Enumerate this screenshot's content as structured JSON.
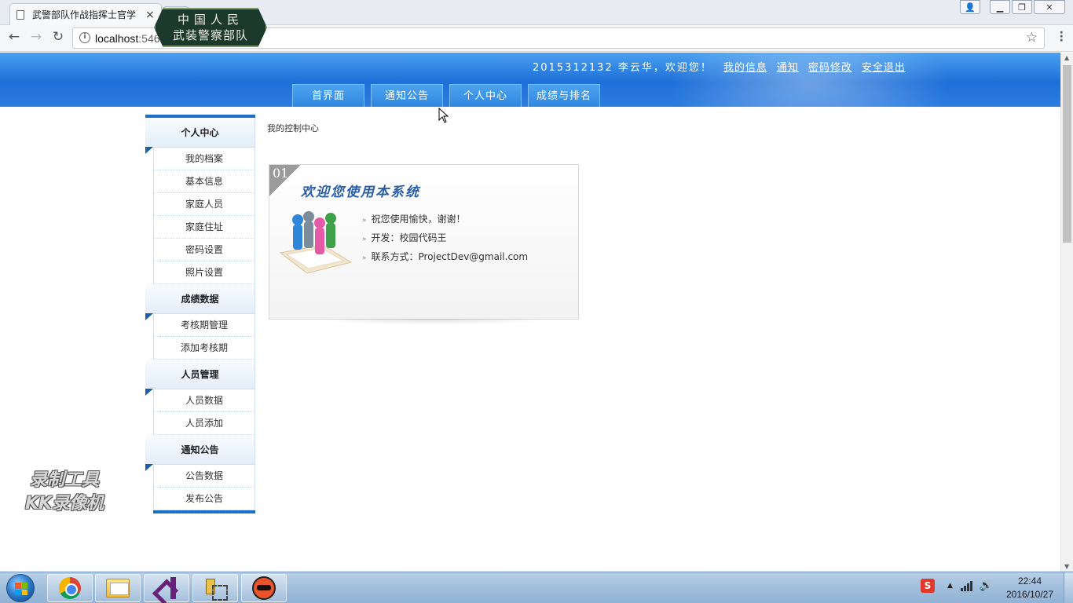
{
  "browser": {
    "tab_title": "武警部队作战指挥士官学",
    "tab_close": "×",
    "url_host": "localhost",
    "url_path": ":5460/Default.aspx",
    "back": "←",
    "forward": "→",
    "reload": "↻",
    "star": "☆",
    "info": "i",
    "win_user": "👤",
    "win_min": "▁",
    "win_restore": "❐",
    "win_close": "✕"
  },
  "header": {
    "logo_line1": "中国人民",
    "logo_line2": "武装警察部队",
    "welcome": "2015312132 李云华，欢迎您！",
    "links": [
      "我的信息",
      "通知",
      "密码修改",
      "安全退出"
    ],
    "nav": [
      "首界面",
      "通知公告",
      "个人中心",
      "成绩与排名"
    ]
  },
  "sidebar": {
    "sections": [
      {
        "title": "个人中心",
        "items": [
          "我的档案",
          "基本信息",
          "家庭人员",
          "家庭住址",
          "密码设置",
          "照片设置"
        ]
      },
      {
        "title": "成绩数据",
        "items": [
          "考核期管理",
          "添加考核期"
        ]
      },
      {
        "title": "人员管理",
        "items": [
          "人员数据",
          "人员添加"
        ]
      },
      {
        "title": "通知公告",
        "items": [
          "公告数据",
          "发布公告"
        ]
      }
    ]
  },
  "content": {
    "breadcrumb": "我的控制中心",
    "box_number": "01",
    "greeting": "欢迎您使用本系统",
    "lines": [
      "祝您使用愉快，谢谢！",
      "开发：校园代码王",
      "联系方式：ProjectDev@gmail.com"
    ],
    "bullet": "»"
  },
  "watermark": {
    "line1": "录制工具",
    "line2": "KK录像机"
  },
  "taskbar": {
    "time": "22:44",
    "date": "2016/10/27",
    "ime": "S"
  }
}
